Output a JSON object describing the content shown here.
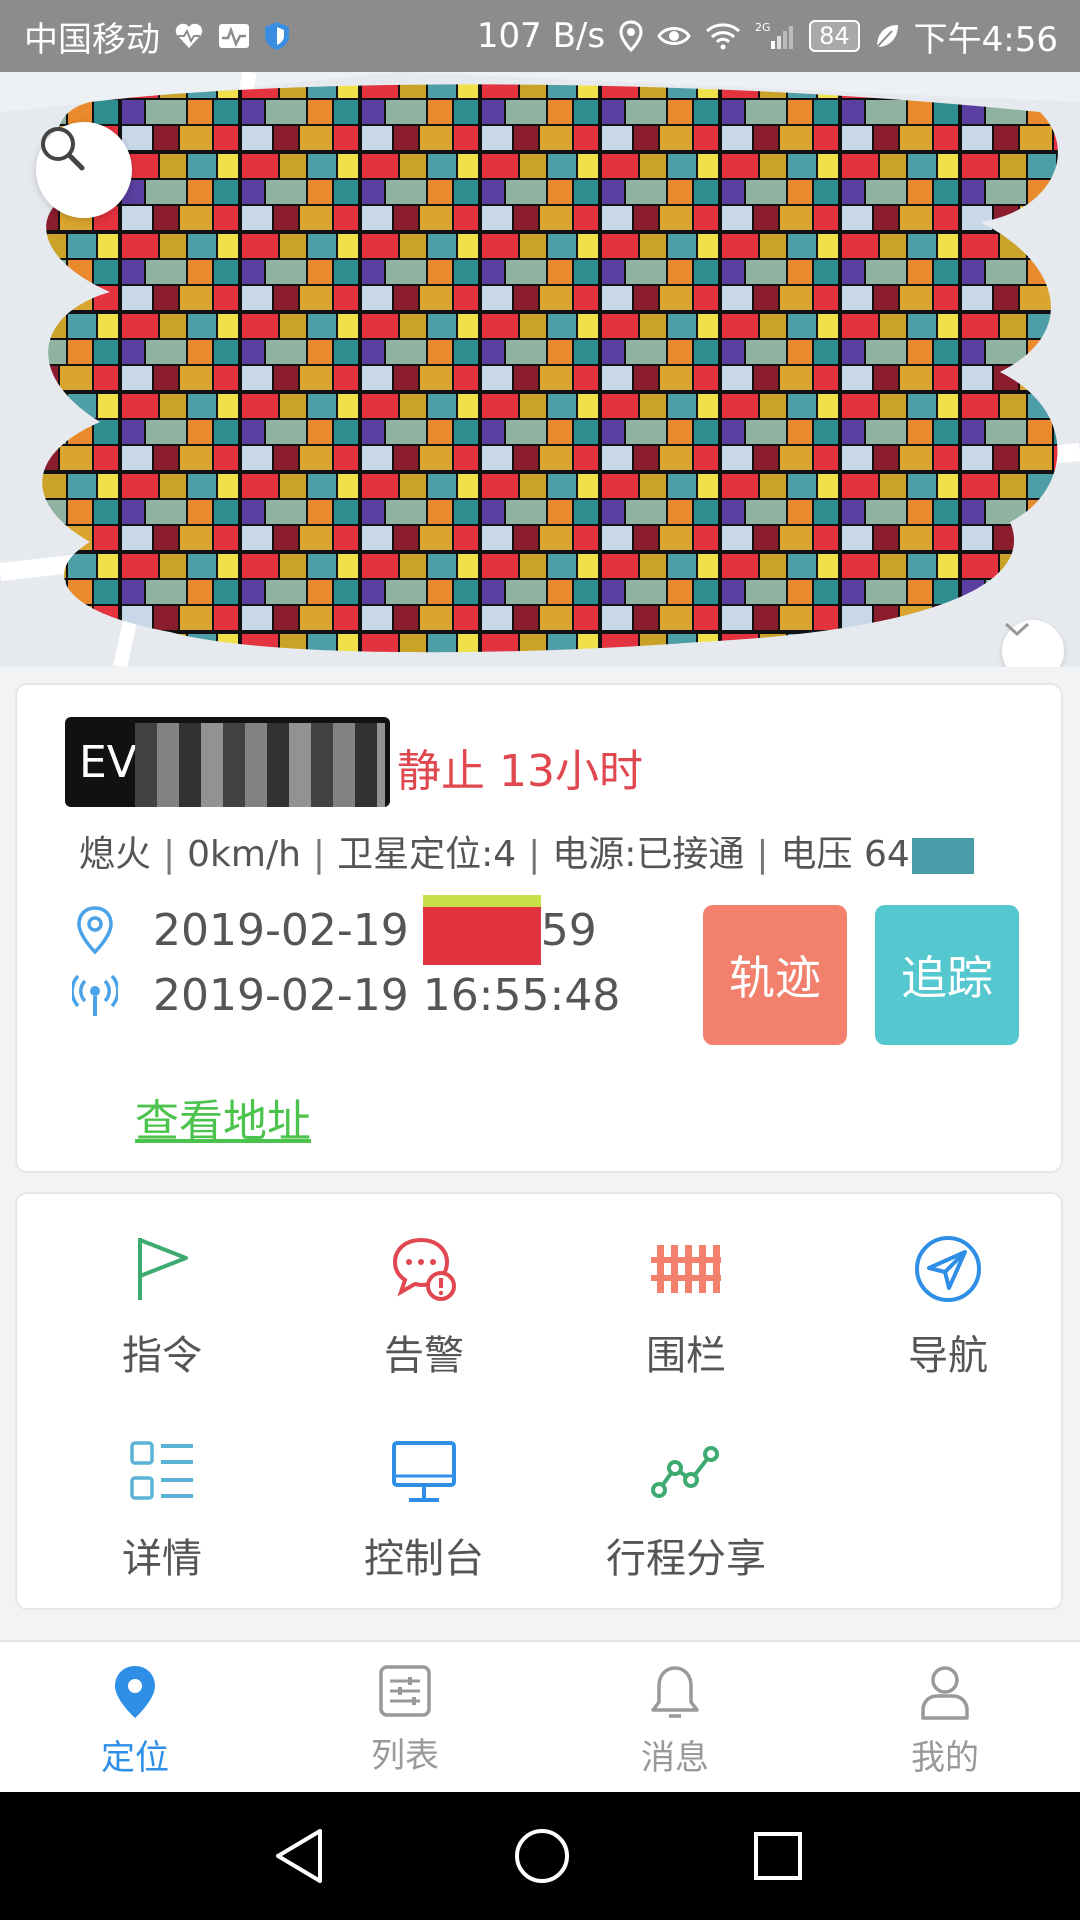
{
  "status_bar": {
    "carrier": "中国移动",
    "net_speed": "107 B/s",
    "network": "2G",
    "battery": "84",
    "time": "下午4:56"
  },
  "map": {
    "search_icon": "search-icon",
    "collapse_icon": "chevron-down-icon"
  },
  "vehicle": {
    "plate": "EV",
    "status": "静止 13小时",
    "info": {
      "ignition": "熄火",
      "speed": "0km/h",
      "satellite": "卫星定位:4",
      "power": "电源:已接通",
      "voltage": "电压 64"
    },
    "gps_time": "2019-02-19",
    "gps_time_tail": "59",
    "signal_time": "2019-02-19 16:55:48",
    "track_label": "轨迹",
    "follow_label": "追踪",
    "address_link": "查看地址"
  },
  "functions": [
    {
      "label": "指令",
      "icon": "flag-icon"
    },
    {
      "label": "告警",
      "icon": "alarm-chat-icon"
    },
    {
      "label": "围栏",
      "icon": "fence-icon"
    },
    {
      "label": "导航",
      "icon": "navigation-icon"
    },
    {
      "label": "详情",
      "icon": "list-detail-icon"
    },
    {
      "label": "控制台",
      "icon": "monitor-icon"
    },
    {
      "label": "行程分享",
      "icon": "trip-share-icon"
    }
  ],
  "tabs": [
    {
      "label": "定位",
      "icon": "location-pin-icon"
    },
    {
      "label": "列表",
      "icon": "list-icon"
    },
    {
      "label": "消息",
      "icon": "bell-icon"
    },
    {
      "label": "我的",
      "icon": "user-icon"
    }
  ],
  "colors": {
    "accent_blue": "#2f8ee6",
    "status_red": "#e0474f",
    "track_button": "#f3806c",
    "follow_button": "#55c7cf",
    "link_green": "#4cc34c"
  }
}
